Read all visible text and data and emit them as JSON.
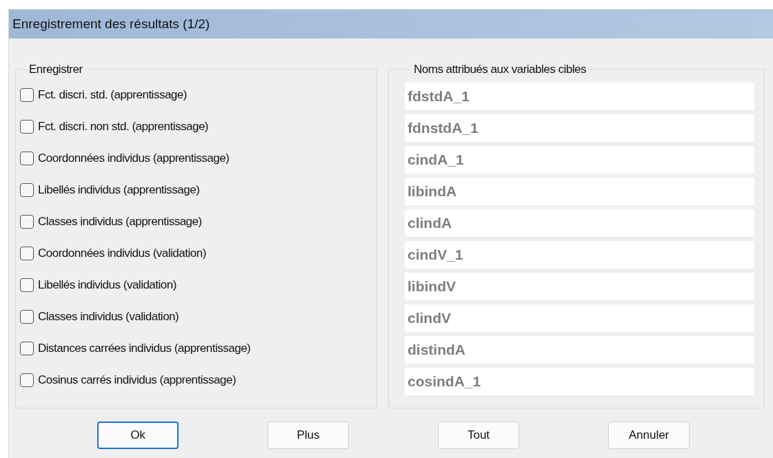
{
  "window": {
    "title": "Enregistrement des résultats (1/2)"
  },
  "save_group": {
    "title": "Enregistrer",
    "options": [
      {
        "label": "Fct. discri. std. (apprentissage)",
        "checked": false
      },
      {
        "label": "Fct. discri. non std. (apprentissage)",
        "checked": false
      },
      {
        "label": "Coordonnées individus (apprentissage)",
        "checked": false
      },
      {
        "label": "Libellés individus (apprentissage)",
        "checked": false
      },
      {
        "label": "Classes individus (apprentissage)",
        "checked": false
      },
      {
        "label": "Coordonnées individus (validation)",
        "checked": false
      },
      {
        "label": "Libellés individus (validation)",
        "checked": false
      },
      {
        "label": "Classes individus (validation)",
        "checked": false
      },
      {
        "label": "Distances carrées individus (apprentissage)",
        "checked": false
      },
      {
        "label": "Cosinus carrés individus (apprentissage)",
        "checked": false
      }
    ]
  },
  "names_group": {
    "title": "Noms attribués aux variables cibles",
    "fields": [
      {
        "value": "fdstdA_1",
        "disabled": true
      },
      {
        "value": "fdnstdA_1",
        "disabled": true
      },
      {
        "value": "cindA_1",
        "disabled": true
      },
      {
        "value": "libindA",
        "disabled": true
      },
      {
        "value": "clindA",
        "disabled": true
      },
      {
        "value": "cindV_1",
        "disabled": true
      },
      {
        "value": "libindV",
        "disabled": true
      },
      {
        "value": "clindV",
        "disabled": true
      },
      {
        "value": "distindA",
        "disabled": true
      },
      {
        "value": "cosindA_1",
        "disabled": true
      }
    ]
  },
  "buttons": [
    {
      "label": "Ok",
      "default": true
    },
    {
      "label": "Plus",
      "default": false
    },
    {
      "label": "Tout",
      "default": false
    },
    {
      "label": "Annuler",
      "default": false
    }
  ]
}
